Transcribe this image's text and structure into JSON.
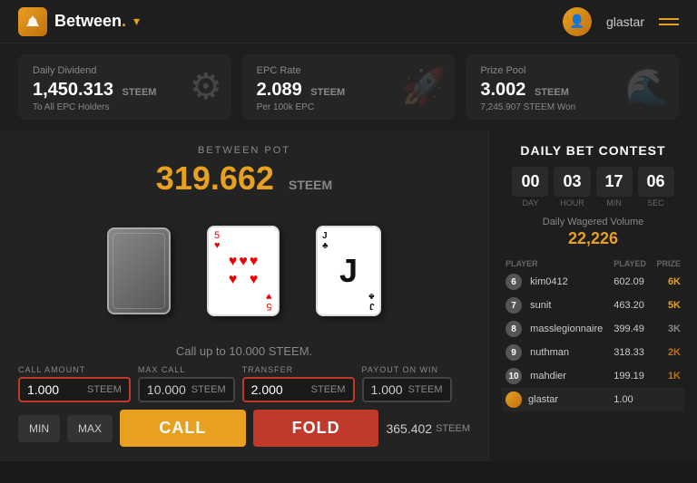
{
  "header": {
    "logo_text": "Between",
    "logo_dot": ".",
    "username": "glastar",
    "chevron": "▾"
  },
  "stats": [
    {
      "label": "Daily Dividend",
      "value": "1,450.313",
      "unit": "STEEM",
      "sub": "To All EPC Holders",
      "icon": "⚙"
    },
    {
      "label": "EPC Rate",
      "value": "2.089",
      "unit": "STEEM",
      "sub": "Per 100k EPC",
      "icon": "🚀"
    },
    {
      "label": "Prize Pool",
      "value": "3.002",
      "unit": "STEEM",
      "sub": "7,245.907 STEEM Won",
      "icon": "🌊"
    }
  ],
  "game": {
    "pot_label": "BETWEEN POT",
    "pot_value": "319.662",
    "pot_unit": "STEEM",
    "call_info": "Call up to 10.000 STEEM.",
    "call_amount_label": "CALL AMOUNT",
    "call_amount_value": "1.000",
    "call_amount_unit": "STEEM",
    "max_call_label": "MAX CALL",
    "max_call_value": "10.000",
    "max_call_unit": "STEEM",
    "transfer_label": "TRANSFER",
    "transfer_value": "2.000",
    "transfer_unit": "STEEM",
    "payout_label": "PAYOUT ON WIN",
    "payout_value": "1.000",
    "payout_unit": "STEEM",
    "btn_min": "MIN",
    "btn_max": "MAX",
    "btn_call": "CALL",
    "btn_fold": "FOLD",
    "fold_payout_value": "365.402",
    "fold_payout_unit": "STEEM"
  },
  "contest": {
    "title": "DAILY BET CONTEST",
    "countdown": [
      {
        "val": "00",
        "label": "DAY"
      },
      {
        "val": "03",
        "label": "HOUR"
      },
      {
        "val": "17",
        "label": "MIN"
      },
      {
        "val": "06",
        "label": "SEC"
      }
    ],
    "wagered_label": "Daily Wagered Volume",
    "wagered_val": "22,226",
    "table_headers": [
      "Player",
      "Played",
      "Prize"
    ],
    "rows": [
      {
        "rank": "6",
        "player": "kim0412",
        "played": "602.09",
        "prize": "6K",
        "prize_class": "prize-6k"
      },
      {
        "rank": "7",
        "player": "sunit",
        "played": "463.20",
        "prize": "5K",
        "prize_class": "prize-5k"
      },
      {
        "rank": "8",
        "player": "masslegionnaire",
        "played": "399.49",
        "prize": "3K",
        "prize_class": "prize-3k"
      },
      {
        "rank": "9",
        "player": "nuthman",
        "played": "318.33",
        "prize": "2K",
        "prize_class": "prize-2k"
      },
      {
        "rank": "10",
        "player": "mahdier",
        "played": "199.19",
        "prize": "1K",
        "prize_class": "prize-1k"
      }
    ],
    "current_user": {
      "player": "glastar",
      "played": "1.00",
      "prize": ""
    }
  }
}
